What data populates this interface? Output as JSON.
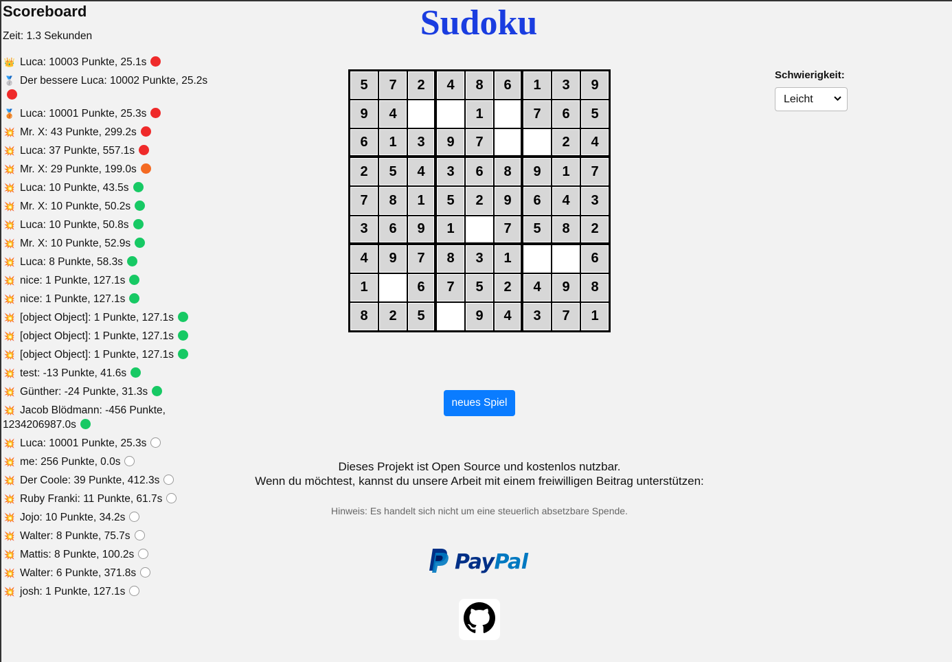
{
  "scoreboard": {
    "title": "Scoreboard",
    "time": "Zeit: 1.3 Sekunden",
    "entries": [
      {
        "icon": "crown",
        "text": "Luca: 10003 Punkte, 25.1s",
        "status": "red"
      },
      {
        "icon": "silver-medal",
        "text": "Der bessere Luca: 10002 Punkte, 25.2s",
        "status": "red"
      },
      {
        "icon": "bronze-medal",
        "text": "Luca: 10001 Punkte, 25.3s",
        "status": "red"
      },
      {
        "icon": "burst",
        "text": "Mr. X: 43 Punkte, 299.2s",
        "status": "red"
      },
      {
        "icon": "burst",
        "text": "Luca: 37 Punkte, 557.1s",
        "status": "red"
      },
      {
        "icon": "burst",
        "text": "Mr. X: 29 Punkte, 199.0s",
        "status": "orange"
      },
      {
        "icon": "burst",
        "text": "Luca: 10 Punkte, 43.5s",
        "status": "green"
      },
      {
        "icon": "burst",
        "text": "Mr. X: 10 Punkte, 50.2s",
        "status": "green"
      },
      {
        "icon": "burst",
        "text": "Luca: 10 Punkte, 50.8s",
        "status": "green"
      },
      {
        "icon": "burst",
        "text": "Mr. X: 10 Punkte, 52.9s",
        "status": "green"
      },
      {
        "icon": "burst",
        "text": "Luca: 8 Punkte, 58.3s",
        "status": "green"
      },
      {
        "icon": "burst",
        "text": "nice: 1 Punkte, 127.1s",
        "status": "green"
      },
      {
        "icon": "burst",
        "text": "nice: 1 Punkte, 127.1s",
        "status": "green"
      },
      {
        "icon": "burst",
        "text": "[object Object]: 1 Punkte, 127.1s",
        "status": "green"
      },
      {
        "icon": "burst",
        "text": "[object Object]: 1 Punkte, 127.1s",
        "status": "green"
      },
      {
        "icon": "burst",
        "text": "[object Object]: 1 Punkte, 127.1s",
        "status": "green"
      },
      {
        "icon": "burst",
        "text": "test: -13 Punkte, 41.6s",
        "status": "green"
      },
      {
        "icon": "burst",
        "text": "Günther: -24 Punkte, 31.3s",
        "status": "green"
      },
      {
        "icon": "burst",
        "text": "Jacob Blödmann: -456 Punkte, 1234206987.0s",
        "status": "green"
      },
      {
        "icon": "burst",
        "text": "Luca: 10001 Punkte, 25.3s",
        "status": "empty"
      },
      {
        "icon": "burst",
        "text": "me: 256 Punkte, 0.0s",
        "status": "empty"
      },
      {
        "icon": "burst",
        "text": "Der Coole: 39 Punkte, 412.3s",
        "status": "empty"
      },
      {
        "icon": "burst",
        "text": "Ruby Franki: 11 Punkte, 61.7s",
        "status": "empty"
      },
      {
        "icon": "burst",
        "text": "Jojo: 10 Punkte, 34.2s",
        "status": "empty"
      },
      {
        "icon": "burst",
        "text": "Walter: 8 Punkte, 75.7s",
        "status": "empty"
      },
      {
        "icon": "burst",
        "text": "Mattis: 8 Punkte, 100.2s",
        "status": "empty"
      },
      {
        "icon": "burst",
        "text": "Walter: 6 Punkte, 371.8s",
        "status": "empty"
      },
      {
        "icon": "burst",
        "text": "josh: 1 Punkte, 127.1s",
        "status": "empty"
      }
    ]
  },
  "title": "Sudoku",
  "board": [
    [
      "5",
      "7",
      "2",
      "4",
      "8",
      "6",
      "1",
      "3",
      "9"
    ],
    [
      "9",
      "4",
      "",
      "",
      "1",
      "",
      "7",
      "6",
      "5"
    ],
    [
      "6",
      "1",
      "3",
      "9",
      "7",
      "",
      "",
      "2",
      "4"
    ],
    [
      "2",
      "5",
      "4",
      "3",
      "6",
      "8",
      "9",
      "1",
      "7"
    ],
    [
      "7",
      "8",
      "1",
      "5",
      "2",
      "9",
      "6",
      "4",
      "3"
    ],
    [
      "3",
      "6",
      "9",
      "1",
      "",
      "7",
      "5",
      "8",
      "2"
    ],
    [
      "4",
      "9",
      "7",
      "8",
      "3",
      "1",
      "",
      "",
      "6"
    ],
    [
      "1",
      "",
      "6",
      "7",
      "5",
      "2",
      "4",
      "9",
      "8"
    ],
    [
      "8",
      "2",
      "5",
      "",
      "9",
      "4",
      "3",
      "7",
      "1"
    ]
  ],
  "difficulty": {
    "label": "Schwierigkeit:",
    "selected": "Leicht"
  },
  "new_game_label": "neues Spiel",
  "donate": {
    "line1": "Dieses Projekt ist Open Source und kostenlos nutzbar.",
    "line2": "Wenn du möchtest, kannst du unsere Arbeit mit einem freiwilligen Beitrag unterstützen:",
    "hint": "Hinweis: Es handelt sich nicht um eine steuerlich absetzbare Spende."
  },
  "paypal": {
    "pay": "Pay",
    "pal": "Pal"
  },
  "colors": {
    "title": "#1a3de0",
    "button": "#0a7cff",
    "status_red": "#ef2a2a",
    "status_orange": "#f46a22",
    "status_green": "#17c964"
  }
}
